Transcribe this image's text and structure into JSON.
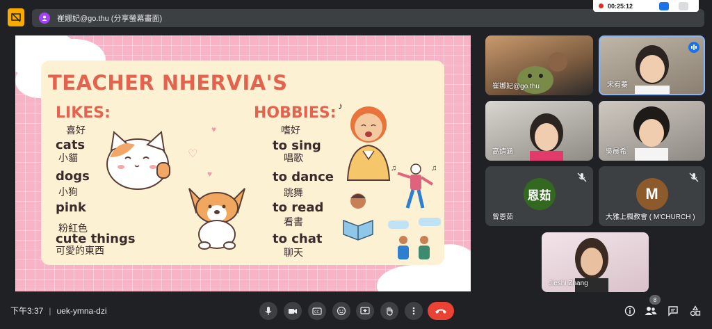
{
  "presenter": {
    "name_label": "崔娜妃@go.thu (分享螢幕畫面)"
  },
  "recording": {
    "time": "00:25:12"
  },
  "slide": {
    "title": "TEACHER NHERVIA'S",
    "likes_heading": "LIKES:",
    "likes_zh": "喜好",
    "hobbies_heading": "HOBBIES:",
    "hobbies_zh": "嗜好",
    "likes": [
      {
        "en": "cats",
        "zh": "小貓"
      },
      {
        "en": "dogs",
        "zh": "小狗"
      },
      {
        "en": "pink",
        "zh": "粉紅色"
      },
      {
        "en": "cute things",
        "zh": "可愛的東西"
      }
    ],
    "hobbies": [
      {
        "en": "to sing",
        "zh": "唱歌"
      },
      {
        "en": "to dance",
        "zh": "跳舞"
      },
      {
        "en": "to read",
        "zh": "看書"
      },
      {
        "en": "to chat",
        "zh": "聊天"
      }
    ]
  },
  "participants": [
    {
      "name": "崔娜妃@go.thu"
    },
    {
      "name": "宋宥蓁"
    },
    {
      "name": "高婧涵"
    },
    {
      "name": "吳晨希"
    },
    {
      "name": "曾恩茹",
      "initials": "恩茹",
      "color": "#33691e"
    },
    {
      "name": "大雅上楓教會 ( M'CHURCH )",
      "initials": "M",
      "color": "#8d5a2b"
    },
    {
      "name": "Jieshi Zhang"
    }
  ],
  "meeting": {
    "time": "下午3:37",
    "code": "uek-ymna-dzi",
    "participant_count": "8"
  },
  "colors": {
    "accent": "#1a73e8",
    "end_call": "#ea4335",
    "bar_bg": "#202124"
  }
}
